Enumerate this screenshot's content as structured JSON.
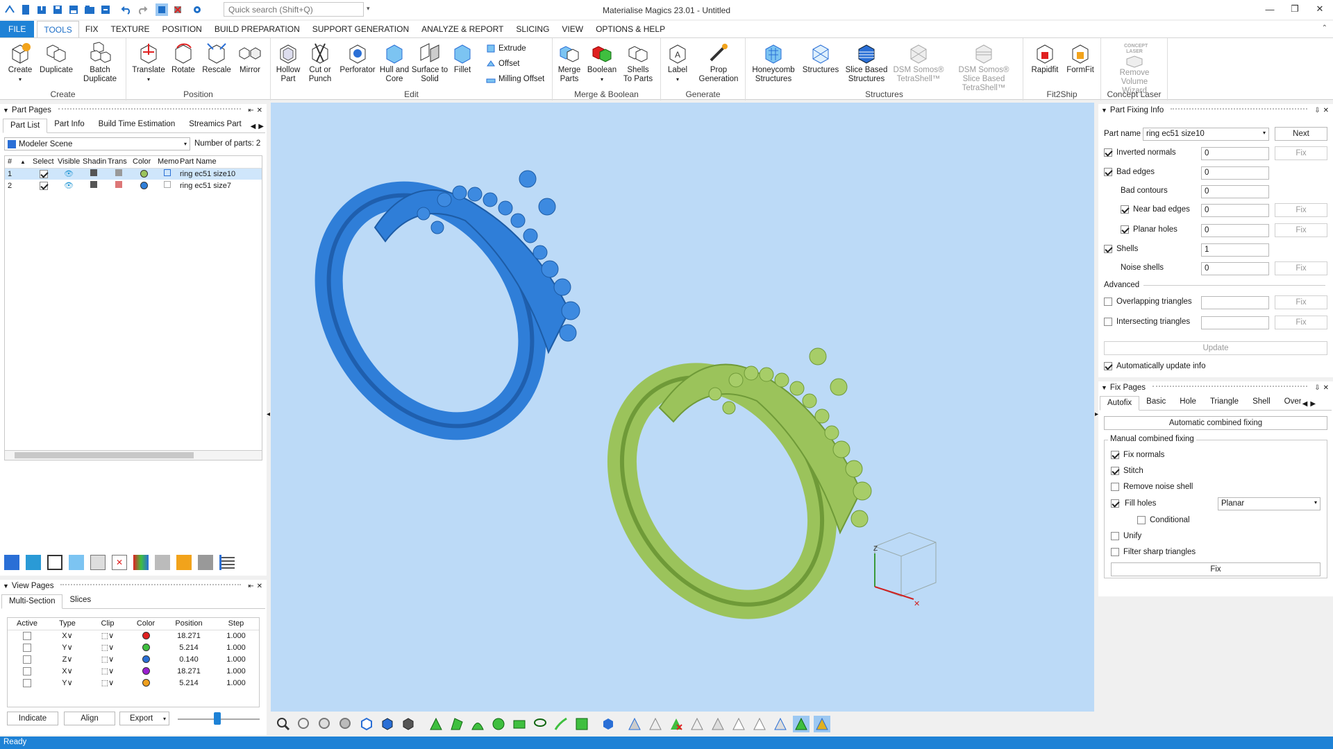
{
  "app": {
    "title": "Materialise Magics 23.01 - Untitled",
    "search_placeholder": "Quick search (Shift+Q)",
    "status": "Ready"
  },
  "menu": [
    "FILE",
    "TOOLS",
    "FIX",
    "TEXTURE",
    "POSITION",
    "BUILD PREPARATION",
    "SUPPORT GENERATION",
    "ANALYZE & REPORT",
    "SLICING",
    "VIEW",
    "OPTIONS & HELP"
  ],
  "ribbon": {
    "create": {
      "name": "Create",
      "create": "Create",
      "duplicate": "Duplicate",
      "batch": "Batch Duplicate"
    },
    "position": {
      "name": "Position",
      "translate": "Translate",
      "rotate": "Rotate",
      "rescale": "Rescale",
      "mirror": "Mirror"
    },
    "edit": {
      "name": "Edit",
      "hollow": "Hollow Part",
      "cut": "Cut or Punch",
      "perforator": "Perforator",
      "hull": "Hull and Core",
      "surface": "Surface to Solid",
      "fillet": "Fillet",
      "extrude": "Extrude",
      "offset": "Offset",
      "milling": "Milling Offset"
    },
    "merge": {
      "name": "Merge & Boolean",
      "merge": "Merge Parts",
      "boolean": "Boolean",
      "shells": "Shells To Parts"
    },
    "generate": {
      "name": "Generate",
      "label": "Label",
      "prop": "Prop Generation"
    },
    "structures": {
      "name": "Structures",
      "honeycomb": "Honeycomb Structures",
      "structures": "Structures",
      "slice": "Slice Based Structures",
      "dsm1": "DSM Somos® TetraShell™",
      "dsm2": "DSM Somos® Slice Based TetraShell™"
    },
    "fit2ship": {
      "name": "Fit2Ship",
      "rapidfit": "Rapidfit",
      "formfit": "FormFit"
    },
    "laser": {
      "name": "Concept Laser",
      "remove": "Remove Volume Wizard",
      "logo": "CONCEPT LASER"
    }
  },
  "part_pages": {
    "title": "Part Pages",
    "tabs": [
      "Part List",
      "Part Info",
      "Build Time Estimation",
      "Streamics Part"
    ],
    "scene": "Modeler Scene",
    "count_label": "Number of parts:",
    "count": "2",
    "columns": [
      "#",
      "Select",
      "Visible",
      "Shading",
      "Trans",
      "Color",
      "Memo",
      "Part Name"
    ],
    "rows": [
      {
        "num": "1",
        "name": "ring ec51 size10",
        "color": "#9bc35b"
      },
      {
        "num": "2",
        "name": "ring ec51 size7",
        "color": "#2f7ed8"
      }
    ]
  },
  "view_pages": {
    "title": "View Pages",
    "tabs": [
      "Multi-Section",
      "Slices"
    ],
    "columns": [
      "Active",
      "Type",
      "Clip",
      "Color",
      "Position",
      "Step"
    ],
    "rows": [
      {
        "type": "X",
        "color": "#e02020",
        "position": "18.271",
        "step": "1.000"
      },
      {
        "type": "Y",
        "color": "#3fbf3f",
        "position": "5.214",
        "step": "1.000"
      },
      {
        "type": "Z",
        "color": "#2a6fd6",
        "position": "0.140",
        "step": "1.000"
      },
      {
        "type": "X",
        "color": "#9a1fd0",
        "position": "18.271",
        "step": "1.000"
      },
      {
        "type": "Y",
        "color": "#f0a01e",
        "position": "5.214",
        "step": "1.000"
      }
    ],
    "indicate": "Indicate",
    "align": "Align",
    "export": "Export"
  },
  "part_fixing": {
    "title": "Part Fixing Info",
    "part_name_label": "Part name",
    "part_name": "ring ec51 size10",
    "next": "Next",
    "fix": "Fix",
    "inverted": "Inverted normals",
    "inverted_val": "0",
    "bad_edges": "Bad edges",
    "bad_edges_val": "0",
    "bad_contours": "Bad contours",
    "bad_contours_val": "0",
    "near_bad": "Near bad edges",
    "near_bad_val": "0",
    "planar": "Planar holes",
    "planar_val": "0",
    "shells": "Shells",
    "shells_val": "1",
    "noise": "Noise shells",
    "noise_val": "0",
    "advanced": "Advanced",
    "overlap": "Overlapping triangles",
    "intersect": "Intersecting triangles",
    "update": "Update",
    "auto_update": "Automatically update info"
  },
  "fix_pages": {
    "title": "Fix Pages",
    "tabs": [
      "Autofix",
      "Basic",
      "Hole",
      "Triangle",
      "Shell",
      "Over"
    ],
    "auto_combined": "Automatic combined fixing",
    "manual": "Manual combined fixing",
    "fix_normals": "Fix normals",
    "stitch": "Stitch",
    "remove_noise": "Remove noise shell",
    "fill_holes": "Fill holes",
    "fill_mode": "Planar",
    "conditional": "Conditional",
    "unify": "Unify",
    "filter": "Filter sharp triangles",
    "fix": "Fix"
  },
  "colors": {
    "accent": "#1e82d6",
    "ring_blue": "#2f7ed8",
    "ring_green": "#9bc35b",
    "viewport": "#bcdaf7"
  }
}
